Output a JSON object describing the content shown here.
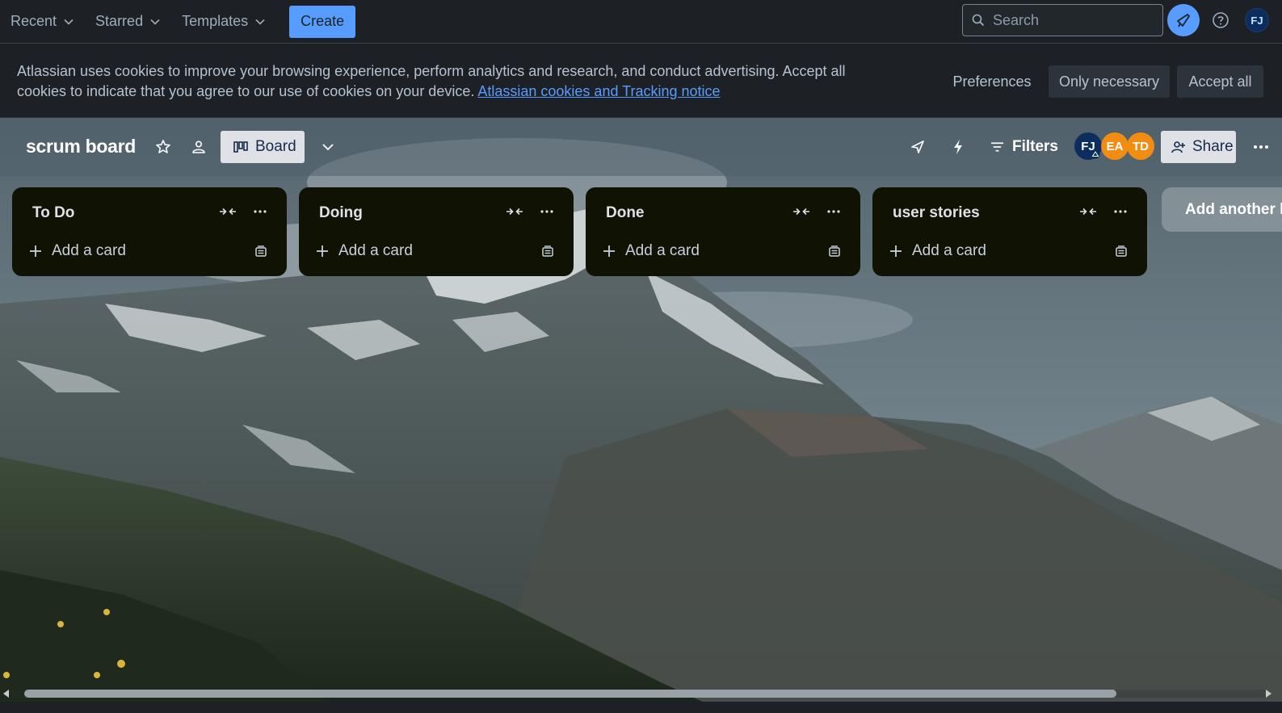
{
  "topnav": {
    "menus": [
      {
        "label": "Recent"
      },
      {
        "label": "Starred"
      },
      {
        "label": "Templates"
      }
    ],
    "create_label": "Create",
    "search_placeholder": "Search",
    "user_initials": "FJ",
    "icons": {
      "chevron": "chevron-down-icon",
      "search": "search-icon",
      "notifications": "megaphone-icon",
      "help": "help-icon"
    }
  },
  "cookie_banner": {
    "text": "Atlassian uses cookies to improve your browsing experience, perform analytics and research, and conduct advertising. Accept all cookies to indicate that you agree to our use of cookies on your device. ",
    "link_text": "Atlassian cookies and Tracking notice",
    "preferences_label": "Preferences",
    "only_necessary_label": "Only necessary",
    "accept_all_label": "Accept all"
  },
  "board": {
    "title": "scrum board",
    "view_label": "Board",
    "filters_label": "Filters",
    "share_label": "Share",
    "members": [
      {
        "initials": "FJ",
        "color": "#0c2e5e",
        "text_color": "#ffffff",
        "is_admin": true
      },
      {
        "initials": "EA",
        "color": "#f18d13",
        "text_color": "#ffffff"
      },
      {
        "initials": "TD",
        "color": "#f18d13",
        "text_color": "#ffffff"
      }
    ],
    "lists": [
      {
        "title": "To Do",
        "add_card_label": "Add a card"
      },
      {
        "title": "Doing",
        "add_card_label": "Add a card"
      },
      {
        "title": "Done",
        "add_card_label": "Add a card"
      },
      {
        "title": "user stories",
        "add_card_label": "Add a card"
      }
    ],
    "add_list_label": "Add another list"
  },
  "colors": {
    "accent": "#579dff",
    "list_bg": "#101204",
    "nav_bg": "#1d2125"
  }
}
